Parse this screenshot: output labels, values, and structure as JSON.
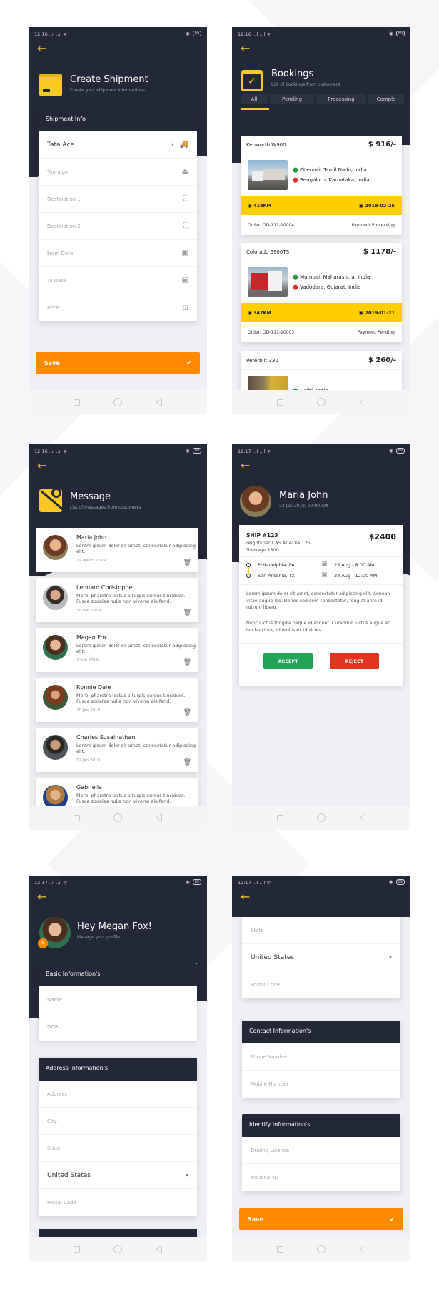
{
  "status_bars": [
    {
      "time": "12:16",
      "battery": "89"
    },
    {
      "time": "12:16",
      "battery": "89"
    },
    {
      "time": "12:16",
      "battery": "89"
    },
    {
      "time": "12:17",
      "battery": "89"
    },
    {
      "time": "12:17",
      "battery": "89"
    },
    {
      "time": "12:17",
      "battery": "89"
    }
  ],
  "create_shipment": {
    "title": "Create Shipment",
    "subtitle": "Create your shipment informations",
    "section_title": "Shipment Info",
    "vehicle_value": "Tata Ace",
    "fields": [
      {
        "placeholder": "Tonnage",
        "icon": "weight-icon"
      },
      {
        "placeholder": "Destination 1",
        "icon": "map-pin-icon"
      },
      {
        "placeholder": "Destination 2",
        "icon": "map-pin-icon"
      },
      {
        "placeholder": "From Date",
        "icon": "calendar-icon"
      },
      {
        "placeholder": "To Date",
        "icon": "calendar-icon"
      },
      {
        "placeholder": "Price",
        "icon": "money-icon"
      }
    ],
    "save_label": "Save"
  },
  "bookings": {
    "title": "Bookings",
    "subtitle": "List of bookings from customers",
    "tabs": [
      "All",
      "Pending",
      "Processing",
      "Comple"
    ],
    "active_tab": "All",
    "items": [
      {
        "name": "Kenworth W900",
        "price": "$ 916/-",
        "from": "Chennai, Tamil Nadu, India",
        "to": "Bengaluru, Karnataka, India",
        "distance": "418KM",
        "date": "2019-02-25",
        "order": "Order: OD-111-10004",
        "payment": "Payment Processing"
      },
      {
        "name": "Colorado 6900TS",
        "price": "$ 1178/-",
        "from": "Mumbai, Maharashtra, India",
        "to": "Vadodara, Gujarat, India",
        "distance": "347KM",
        "date": "2019-01-21",
        "order": "Order: OD-111-10003",
        "payment": "Payment Pending"
      },
      {
        "name": "Peterbilt 330",
        "price": "$ 260/-",
        "from": "Delhi, India",
        "to": "",
        "distance": "",
        "date": "",
        "order": "",
        "payment": ""
      }
    ]
  },
  "messages": {
    "title": "Message",
    "subtitle": "List of messages from customers",
    "items": [
      {
        "name": "Maria John",
        "text": "Lorem ipsum dolor sit amet, consectetur adipiscing elit.",
        "date": "22 March 2019"
      },
      {
        "name": "Leonard Christopher",
        "text": "Morbi pharetra lectus a turpis cursus tincidunt. Fusce sodales nulla non viverra eleifend.",
        "date": "16 Feb 2019"
      },
      {
        "name": "Megan Fox",
        "text": "Lorem ipsum dolor sit amet, consectetur adipiscing elit.",
        "date": "2 Feb 2019"
      },
      {
        "name": "Ronnie Dale",
        "text": "Morbi pharetra lectus a turpis cursus tincidunt. Fusce sodales nulla non viverra eleifend.",
        "date": "20 Jan 2019"
      },
      {
        "name": "Charles Susainathan",
        "text": "Lorem ipsum dolor sit amet, consectetur adipiscing elit.",
        "date": "12 Jan 2019"
      },
      {
        "name": "Gabriella",
        "text": "Morbi pharetra lectus a turpis cursus tincidunt. Fusce sodales nulla non viverra eleifend.",
        "date": ""
      }
    ]
  },
  "message_detail": {
    "name": "Maria John",
    "datetime": "22 Jan 2019, 07:00 AM",
    "ship_id": "SHIP #123",
    "vehicle": "reightliner CAS ACADIA 125",
    "tonnage": "Tonnage 1500",
    "price": "$2400",
    "from": "Philadelphia, PA",
    "to": "San Antonio, TX",
    "from_time": "25 Aug - 8:00 AM",
    "to_time": "28 Aug - 12:00 AM",
    "para1": "Lorem ipsum dolor sit amet, consectetur adipiscing elit. Aenean vitae augue leo. Donec sed sem consectetur, feugiat ante id, rutrum libero.",
    "para2": "Nunc luctus fringilla neque id aliquet. Curabitur luctus augue ac leo faucibus, id mollis ex ultricies.",
    "accept_label": "ACCEPT",
    "reject_label": "REJECT"
  },
  "profile": {
    "title": "Hey Megan Fox!",
    "subtitle": "Manage your profile",
    "basic_title": "Basic Information's",
    "basic_fields": [
      "Name",
      "DOB"
    ],
    "address_title": "Address Information's",
    "address_fields": [
      "Address",
      "City",
      "State"
    ],
    "country_value": "United States",
    "postal_placeholder": "Postal Code"
  },
  "profile_scrolled": {
    "state_placeholder": "State",
    "country_value": "United States",
    "postal_placeholder": "Postal Code",
    "contact_title": "Contact Information's",
    "contact_fields": [
      "Phone Number",
      "Mobile Number"
    ],
    "identify_title": "Identify Information's",
    "identify_fields": [
      "Driving Licence",
      "National ID"
    ],
    "save_label": "Save"
  },
  "colors": {
    "dark": "#232838",
    "accent_yellow": "#f7c926",
    "save_orange": "#ff8a00",
    "accept_green": "#1fa554",
    "reject_red": "#e0361f"
  }
}
